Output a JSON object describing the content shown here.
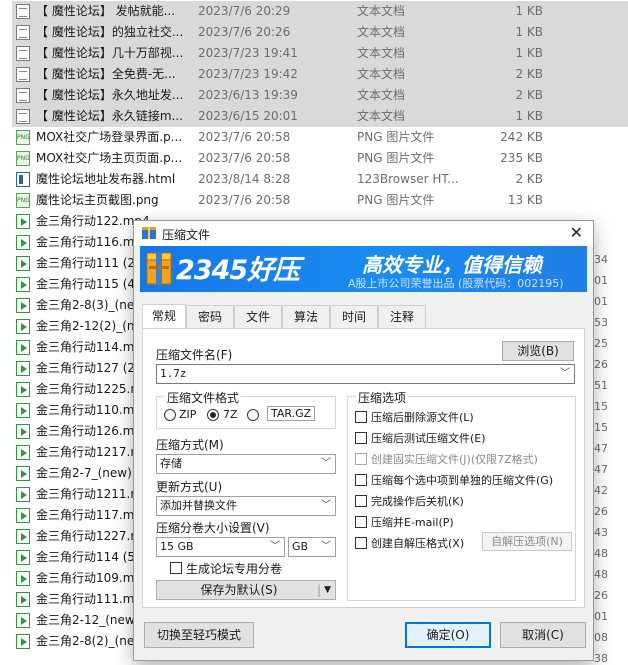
{
  "files": [
    {
      "name": "【 魔性论坛】 发帖就能...",
      "date": "2023/7/6 20:29",
      "type": "文本文档",
      "size": "1 KB",
      "icon": "txt-icon"
    },
    {
      "name": "【 魔性论坛】的独立社交...",
      "date": "2023/7/6 20:26",
      "type": "文本文档",
      "size": "1 KB",
      "icon": "txt-icon"
    },
    {
      "name": "【 魔性论坛】几十万部视...",
      "date": "2023/7/23 19:41",
      "type": "文本文档",
      "size": "1 KB",
      "icon": "txt-icon"
    },
    {
      "name": "【 魔性论坛】全免费-无...",
      "date": "2023/7/23 19:42",
      "type": "文本文档",
      "size": "2 KB",
      "icon": "txt-icon"
    },
    {
      "name": "【 魔性论坛】永久地址发...",
      "date": "2023/6/13 19:39",
      "type": "文本文档",
      "size": "2 KB",
      "icon": "txt-icon"
    },
    {
      "name": "【 魔性论坛】永久链接m...",
      "date": "2023/6/15 20:01",
      "type": "文本文档",
      "size": "1 KB",
      "icon": "txt-icon"
    },
    {
      "name": "MOX社交广场登录界面.p...",
      "date": "2023/7/6 20:58",
      "type": "PNG 图片文件",
      "size": "242 KB",
      "icon": "png-icon"
    },
    {
      "name": "MOX社交广场主页页面.p...",
      "date": "2023/7/6 20:58",
      "type": "PNG 图片文件",
      "size": "235 KB",
      "icon": "png-icon"
    },
    {
      "name": "魔性论坛地址发布器.html",
      "date": "2023/8/14 8:28",
      "type": "123Browser HT...",
      "size": "2 KB",
      "icon": "html-icon"
    },
    {
      "name": "魔性论坛主页截图.png",
      "date": "2023/7/6 20:58",
      "type": "PNG 图片文件",
      "size": "13 KB",
      "icon": "png-icon"
    },
    {
      "name": "金三角行动122.mp4",
      "date": "",
      "type": "",
      "size": "",
      "icon": "mp4-icon"
    },
    {
      "name": "金三角行动116.mp",
      "date": "",
      "type": "",
      "size": "",
      "icon": "mp4-icon"
    },
    {
      "name": "金三角行动111  (2",
      "date": "",
      "type": "",
      "size": "",
      "icon": "mp4-icon"
    },
    {
      "name": "金三角行动115  (4",
      "date": "",
      "type": "",
      "size": "",
      "icon": "mp4-icon"
    },
    {
      "name": "金三角2-8(3)_(new",
      "date": "",
      "type": "",
      "size": "",
      "icon": "mp4-icon"
    },
    {
      "name": "金三角2-12(2)_(ne",
      "date": "",
      "type": "",
      "size": "",
      "icon": "mp4-icon"
    },
    {
      "name": "金三角行动114.mp",
      "date": "",
      "type": "",
      "size": "",
      "icon": "mp4-icon"
    },
    {
      "name": "金三角行动127  (2",
      "date": "",
      "type": "",
      "size": "",
      "icon": "mp4-icon"
    },
    {
      "name": "金三角行动1225.m",
      "date": "",
      "type": "",
      "size": "",
      "icon": "mp4-icon"
    },
    {
      "name": "金三角行动110.mp",
      "date": "",
      "type": "",
      "size": "",
      "icon": "mp4-icon"
    },
    {
      "name": "金三角行动126.mp",
      "date": "",
      "type": "",
      "size": "",
      "icon": "mp4-icon"
    },
    {
      "name": "金三角行动1217.m",
      "date": "",
      "type": "",
      "size": "",
      "icon": "mp4-icon"
    },
    {
      "name": "金三角2-7_(new).a",
      "date": "",
      "type": "",
      "size": "",
      "icon": "mp4-icon"
    },
    {
      "name": "金三角行动1211.m",
      "date": "",
      "type": "",
      "size": "",
      "icon": "mp4-icon"
    },
    {
      "name": "金三角行动117.mp",
      "date": "",
      "type": "",
      "size": "",
      "icon": "mp4-icon"
    },
    {
      "name": "金三角行动1227.m",
      "date": "",
      "type": "",
      "size": "",
      "icon": "mp4-icon"
    },
    {
      "name": "金三角行动114  (5",
      "date": "",
      "type": "",
      "size": "",
      "icon": "mp4-icon"
    },
    {
      "name": "金三角行动109.mp",
      "date": "",
      "type": "",
      "size": "",
      "icon": "mp4-icon"
    },
    {
      "name": "金三角行动111.mp",
      "date": "",
      "type": "",
      "size": "",
      "icon": "mp4-icon"
    },
    {
      "name": "金三角2-12_(new).",
      "date": "",
      "type": "",
      "size": "",
      "icon": "mp4-icon"
    },
    {
      "name": "金三角2-8(2)_(new",
      "date": "",
      "type": "",
      "size": "",
      "icon": "mp4-icon"
    }
  ],
  "right_peek": [
    "34",
    "01",
    "01",
    "53",
    "25",
    "26",
    "51",
    "15",
    "15",
    "47",
    "47",
    "42",
    "26",
    "43",
    "48",
    "48",
    "26",
    "01",
    "08",
    "38"
  ],
  "dialog": {
    "title": "压缩文件",
    "banner_logo": "2345好压",
    "banner_slogan": "高效专业，值得信赖",
    "banner_sub": "A股上市公司荣誉出品 (股票代码：002195)",
    "tabs": [
      "常规",
      "密码",
      "文件",
      "算法",
      "时间",
      "注释"
    ],
    "active_tab": "常规",
    "archive_name_label": "压缩文件名(F)",
    "browse_button": "浏览(B)",
    "archive_name_value": "1.7z",
    "format_group_title": "压缩文件格式",
    "formats": [
      {
        "label": "ZIP",
        "selected": false
      },
      {
        "label": "7Z",
        "selected": true
      },
      {
        "label": "TAR.GZ",
        "selected": false
      }
    ],
    "method_label": "压缩方式(M)",
    "method_value": "存储",
    "update_label": "更新方式(U)",
    "update_value": "添加并替换文件",
    "split_label": "压缩分卷大小设置(V)",
    "split_value": "15 GB",
    "split_unit": "GB",
    "forum_volume_label": "生成论坛专用分卷",
    "save_default_button": "保存为默认(S)",
    "options_group_title": "压缩选项",
    "options": [
      {
        "label": "压缩后删除源文件(L)",
        "checked": false,
        "disabled": false
      },
      {
        "label": "压缩后测试压缩文件(E)",
        "checked": false,
        "disabled": false
      },
      {
        "label": "创建固实压缩文件(J)(仅限7Z格式)",
        "checked": false,
        "disabled": true
      },
      {
        "label": "压缩每个选中项到单独的压缩文件(G)",
        "checked": false,
        "disabled": false
      },
      {
        "label": "完成操作后关机(K)",
        "checked": false,
        "disabled": false
      },
      {
        "label": "压缩并E-mail(P)",
        "checked": false,
        "disabled": false
      },
      {
        "label": "创建自解压格式(X)",
        "checked": false,
        "disabled": false
      }
    ],
    "sfx_options_button": "自解压选项(N)",
    "lite_mode_button": "切换至轻巧模式",
    "ok_button": "确定(O)",
    "cancel_button": "取消(C)"
  },
  "colors": {
    "banner": "#1677e8",
    "selection": "#d9d9d9",
    "accent": "#0078d7"
  }
}
